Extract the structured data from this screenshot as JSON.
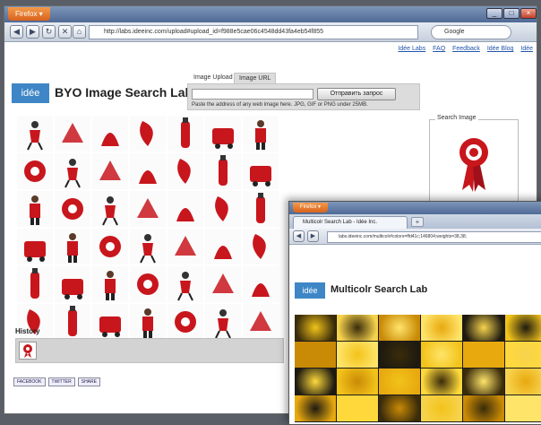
{
  "browser": {
    "menu_label": "Firefox",
    "url": "http://labs.ideeinc.com/upload#upload_id=f988e5cae06c4548dd43fa4eb54f855",
    "search_engine": "Google",
    "min_icon": "minimize-icon",
    "max_icon": "maximize-icon",
    "close_icon": "close-icon"
  },
  "page": {
    "top_links": [
      "Idée Labs",
      "FAQ",
      "Feedback",
      "Idée Blog",
      "Idée"
    ],
    "logo": "idée",
    "title": "BYO Image Search Lab",
    "tabs": [
      "Image Upload",
      "Image URL"
    ],
    "submit_label": "Отправить запрос",
    "hint": "Paste the address of any web image here. JPG, GIF or PNG under 25MB.",
    "search_image_label": "Search Image",
    "history_label": "History",
    "share_buttons": [
      "FACEBOOK",
      "TWITTER",
      "SHARE"
    ],
    "accent_color": "#3e86c6",
    "red_color": "#c8161d"
  },
  "second_window": {
    "menu_label": "Firefox",
    "tab_title": "Multicolr Search Lab - Idée Inc.",
    "new_tab": "+",
    "url": "labs.ideeinc.com/multicolr#colors=ffd41c;146804;weights=38,38;",
    "logo": "idée",
    "title": "Multicolr Search Lab"
  }
}
